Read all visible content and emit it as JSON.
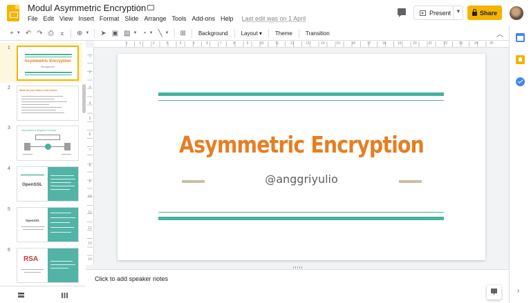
{
  "header": {
    "title": "Modul Asymmetric Encryption",
    "menu": [
      "File",
      "Edit",
      "View",
      "Insert",
      "Format",
      "Slide",
      "Arrange",
      "Tools",
      "Add-ons",
      "Help"
    ],
    "last_edit": "Last edit was on 1 April",
    "present_label": "Present",
    "share_label": "Share"
  },
  "toolbar": {
    "background_label": "Background",
    "layout_label": "Layout",
    "theme_label": "Theme",
    "transition_label": "Transition"
  },
  "slides": [
    {
      "number": "1",
      "title": "Asymmetric Encryption",
      "subtitle": "@anggriyulio"
    },
    {
      "number": "2",
      "title": "What did you learn in this lesson"
    },
    {
      "number": "3",
      "heading": "Asymmetric Encryption Concept"
    },
    {
      "number": "4",
      "logo": "OpenSSL"
    },
    {
      "number": "5",
      "logo": "OpenSSL"
    },
    {
      "number": "6",
      "logo": "RSA"
    }
  ],
  "main_slide": {
    "title": "Asymmetric Encryption",
    "subtitle": "@anggriyulio"
  },
  "ruler": {
    "h": [
      "1",
      "1",
      "2",
      "3",
      "4",
      "5",
      "6",
      "7",
      "8",
      "9",
      "10",
      "11",
      "12",
      "13",
      "14",
      "15",
      "16",
      "17",
      "18",
      "19",
      "20",
      "21",
      "22",
      "23",
      "24",
      "25"
    ],
    "v": [
      "1",
      "2",
      "3",
      "4",
      "5",
      "6",
      "7",
      "8",
      "9",
      "10",
      "11",
      "12",
      "13",
      "14"
    ]
  },
  "notes": {
    "placeholder": "Click to add speaker notes"
  },
  "colors": {
    "accent": "#f4b400",
    "title_orange": "#e67e22",
    "teal": "#45b39d"
  }
}
